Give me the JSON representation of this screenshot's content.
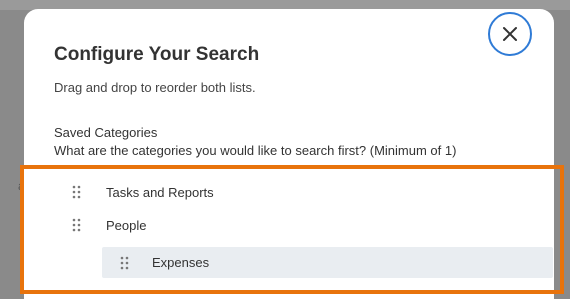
{
  "dialog": {
    "title": "Configure Your Search",
    "subtitle": "Drag and drop to reorder both lists.",
    "close_icon": "close-icon",
    "accent_color": "#2f7bd6"
  },
  "saved_categories": {
    "label": "Saved Categories",
    "question": "What are the categories you would like to search first? (Minimum of 1)",
    "items": [
      {
        "label": "Tasks and Reports",
        "icon": "drag-handle-icon"
      },
      {
        "label": "People",
        "icon": "drag-handle-icon"
      },
      {
        "label": "Expenses",
        "icon": "drag-handle-icon",
        "state": "dragging"
      }
    ]
  },
  "highlight": {
    "color": "#e8730c"
  },
  "background_fragment": {
    "glyph": "a"
  }
}
